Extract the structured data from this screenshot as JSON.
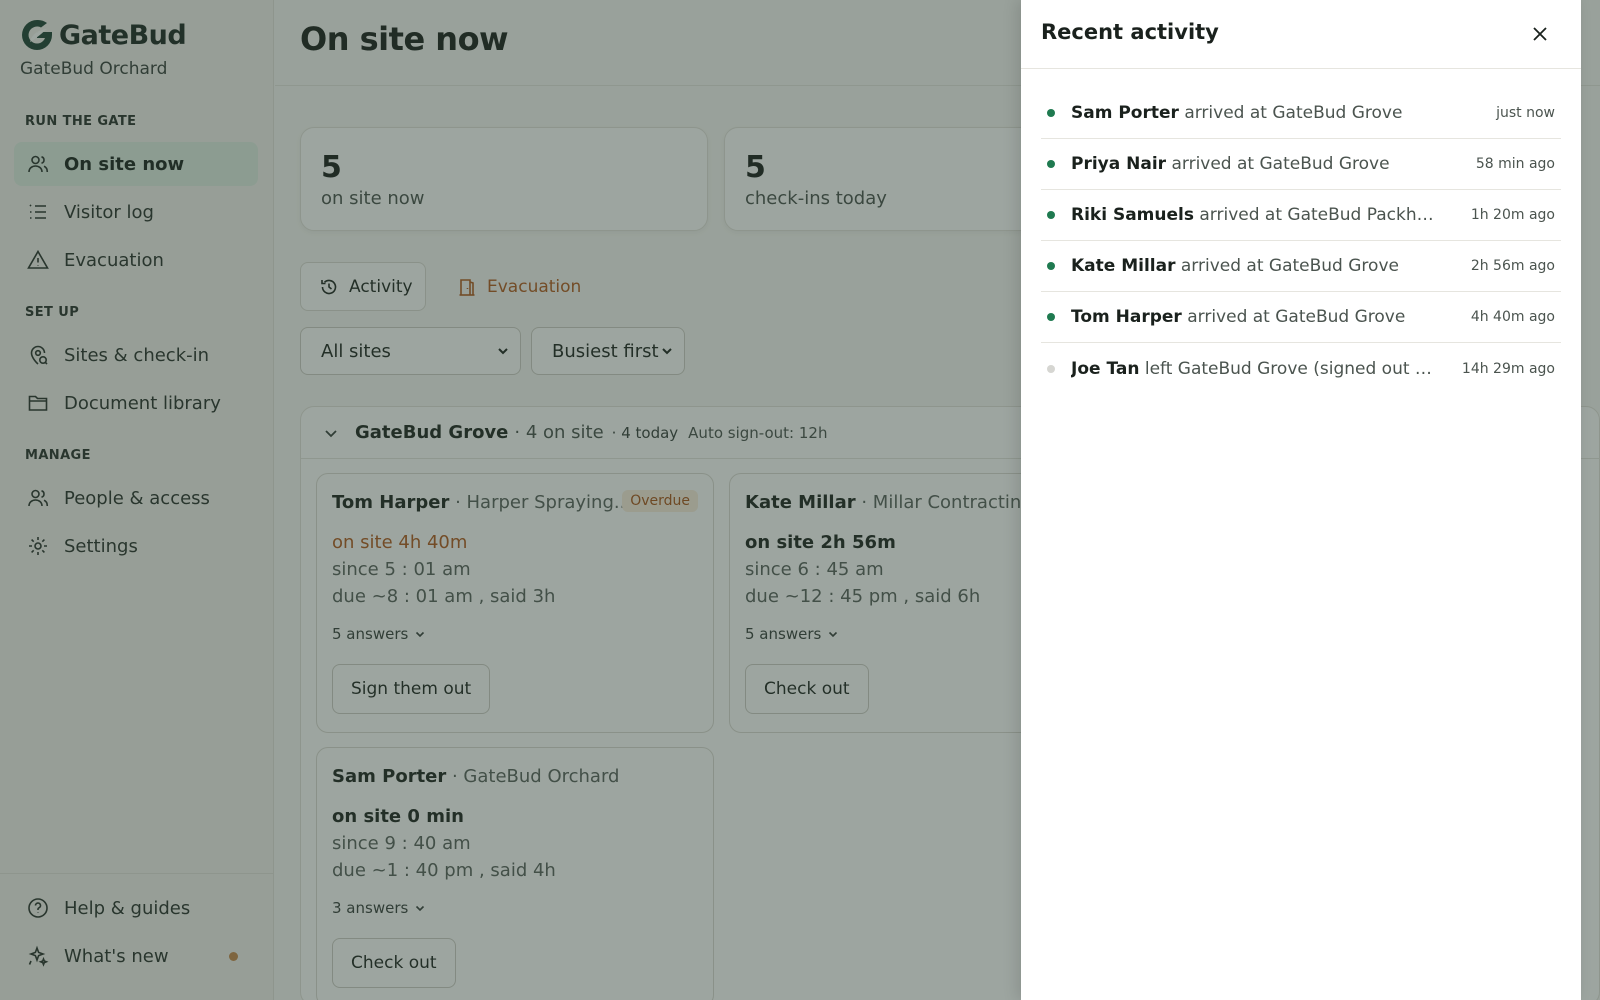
{
  "brand": {
    "name": "GateBud",
    "org": "GateBud Orchard"
  },
  "nav": {
    "sections": [
      {
        "label": "RUN THE GATE"
      },
      {
        "label": "SET UP"
      },
      {
        "label": "MANAGE"
      }
    ],
    "items": [
      {
        "label": "On site now",
        "icon": "people-icon",
        "active": true
      },
      {
        "label": "Visitor log",
        "icon": "list-icon"
      },
      {
        "label": "Evacuation",
        "icon": "warning-icon"
      },
      {
        "label": "Sites & check-in",
        "icon": "map-pin-icon"
      },
      {
        "label": "Document library",
        "icon": "folder-icon"
      },
      {
        "label": "People & access",
        "icon": "users-icon"
      },
      {
        "label": "Settings",
        "icon": "gear-icon"
      }
    ],
    "footer": [
      {
        "label": "Help & guides",
        "icon": "help-icon"
      },
      {
        "label": "What's new",
        "icon": "sparkle-icon"
      }
    ]
  },
  "page": {
    "title": "On site now"
  },
  "stats": [
    {
      "value": "5",
      "label": "on site now"
    },
    {
      "value": "5",
      "label": "check-ins today"
    }
  ],
  "tabs": {
    "activity": "Activity",
    "evacuation": "Evacuation"
  },
  "filters": {
    "site": "All sites",
    "sort": "Busiest first"
  },
  "group": {
    "name": "GateBud Grove",
    "on_site": "· 4 on site",
    "today": "· 4 today",
    "auto": "Auto sign-out: 12h"
  },
  "visitors": [
    {
      "name": "Tom Harper",
      "company": " · Harper Spraying...",
      "badge": "Overdue",
      "duration": "on site 4h 40m",
      "since": "since 5 : 01 am",
      "due": "due ~8 : 01 am ,  said 3h",
      "answers": "5 answers",
      "action": "Sign them out"
    },
    {
      "name": "Kate Millar",
      "company": " · Millar Contracting",
      "duration": "on site 2h 56m",
      "since": "since 6 : 45 am",
      "due": "due ~12 : 45 pm ,  said 6h",
      "answers": "5 answers",
      "action": "Check out"
    },
    {
      "name": "Sam Porter",
      "company": " · GateBud Orchard",
      "duration": "on site 0 min",
      "since": "since 9 : 40 am",
      "due": "due ~1 : 40 pm ,  said 4h",
      "answers": "3 answers",
      "action": "Check out"
    }
  ],
  "drawer": {
    "title": "Recent activity",
    "items": [
      {
        "who": "Sam Porter",
        "text": " arrived at GateBud Grove",
        "time": "just now",
        "status": "arrived"
      },
      {
        "who": "Priya Nair",
        "text": " arrived at GateBud Grove",
        "time": "58 min ago",
        "status": "arrived"
      },
      {
        "who": "Riki Samuels",
        "text": " arrived at GateBud Packhouse",
        "time": "1h 20m ago",
        "status": "arrived"
      },
      {
        "who": "Kate Millar",
        "text": " arrived at GateBud Grove",
        "time": "2h 56m ago",
        "status": "arrived"
      },
      {
        "who": "Tom Harper",
        "text": " arrived at GateBud Grove",
        "time": "4h 40m ago",
        "status": "arrived"
      },
      {
        "who": "Joe Tan",
        "text": " left GateBud Grove (signed out auto...",
        "time": "14h 29m ago",
        "status": "left"
      }
    ]
  },
  "colors": {
    "accent": "#1f7a50",
    "active_nav": "#dfeee4",
    "overdue": "#b25c20",
    "arrived_dot": "#1f7a50",
    "left_dot": "#d6d6d2",
    "new_dot": "#c68a4d"
  }
}
